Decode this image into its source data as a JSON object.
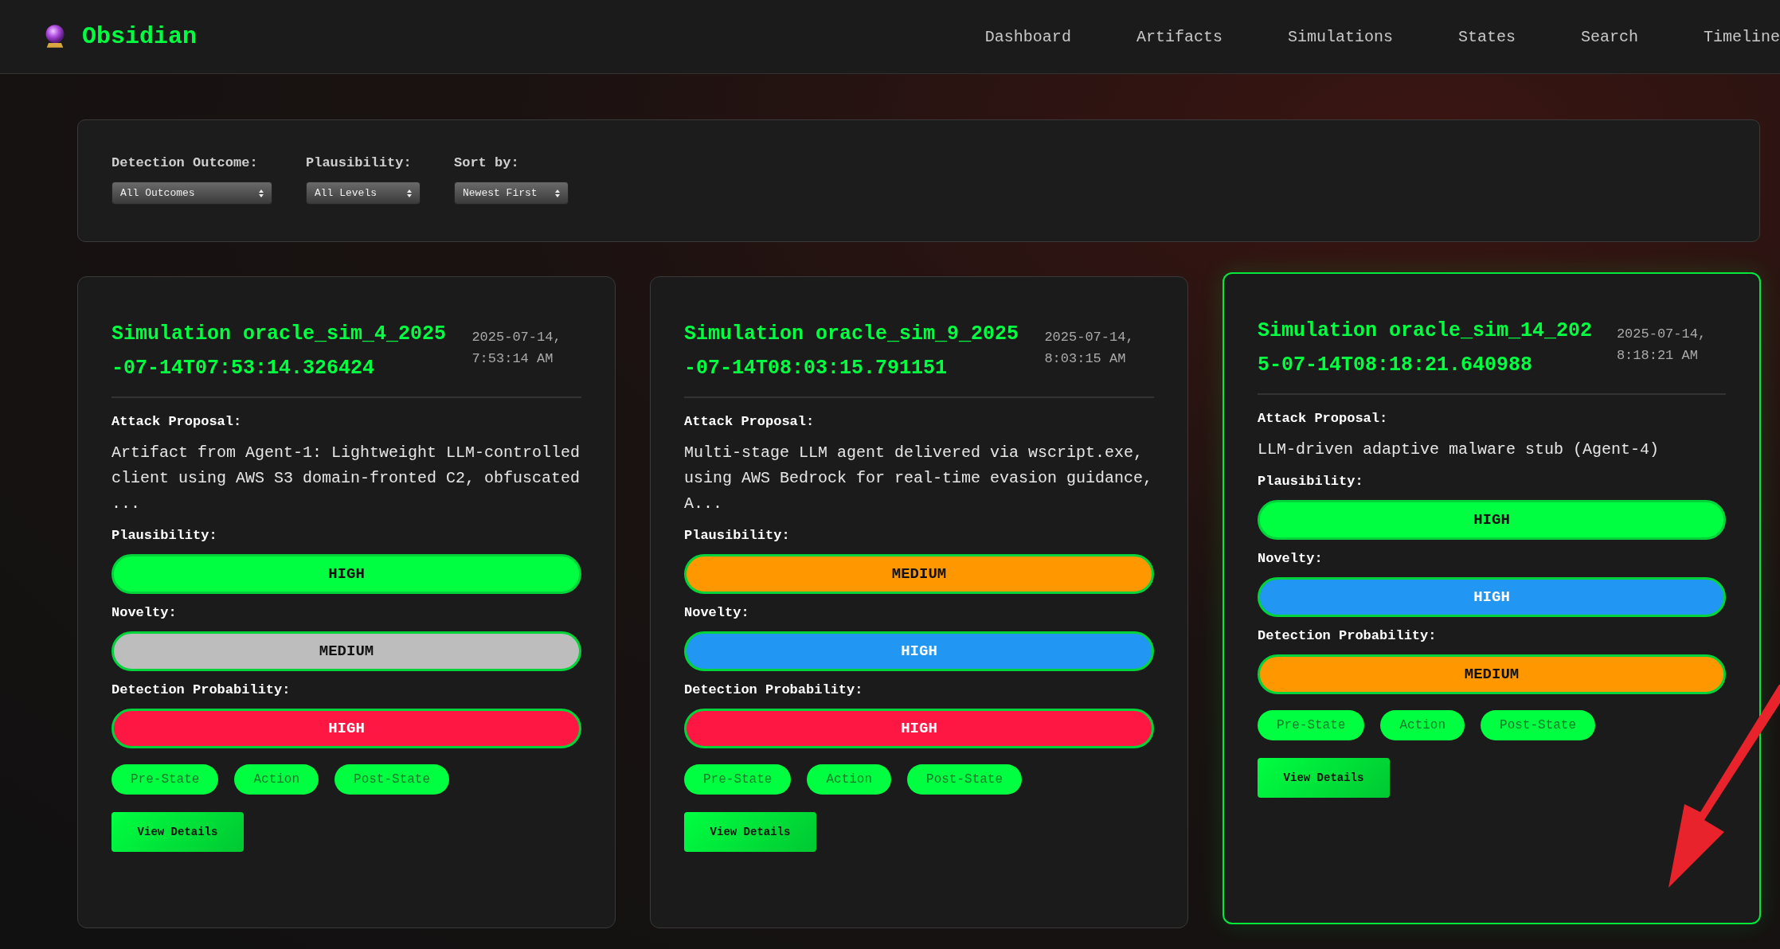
{
  "app": {
    "name": "Obsidian"
  },
  "nav": [
    {
      "label": "Dashboard"
    },
    {
      "label": "Artifacts"
    },
    {
      "label": "Simulations"
    },
    {
      "label": "States"
    },
    {
      "label": "Search"
    },
    {
      "label": "Timeline"
    }
  ],
  "filters": [
    {
      "label": "Detection Outcome:",
      "value": "All Outcomes"
    },
    {
      "label": "Plausibility:",
      "value": "All Levels"
    },
    {
      "label": "Sort by:",
      "value": "Newest First"
    }
  ],
  "cards": [
    {
      "title": "Simulation oracle_sim_4_2025-07-14T07:53:14.326424",
      "date": "2025-07-14, 7:53:14 AM",
      "highlighted": false,
      "proposal_label": "Attack Proposal:",
      "proposal": "Artifact from Agent-1: Lightweight LLM-controlled client using AWS S3 domain-fronted C2, obfuscated ...",
      "ratings": [
        {
          "label": "Plausibility:",
          "value": "HIGH",
          "color": "#00ff41"
        },
        {
          "label": "Novelty:",
          "value": "MEDIUM",
          "color": "#bdbdbd"
        },
        {
          "label": "Detection Probability:",
          "value": "HIGH",
          "color": "#ff1744"
        }
      ],
      "tags": [
        "Pre-State",
        "Action",
        "Post-State"
      ],
      "button": "View Details"
    },
    {
      "title": "Simulation oracle_sim_9_2025-07-14T08:03:15.791151",
      "date": "2025-07-14, 8:03:15 AM",
      "highlighted": false,
      "proposal_label": "Attack Proposal:",
      "proposal": "Multi-stage LLM agent delivered via wscript.exe, using AWS Bedrock for real-time evasion guidance, A...",
      "ratings": [
        {
          "label": "Plausibility:",
          "value": "MEDIUM",
          "color": "#ff9800"
        },
        {
          "label": "Novelty:",
          "value": "HIGH",
          "color": "#2196f3"
        },
        {
          "label": "Detection Probability:",
          "value": "HIGH",
          "color": "#ff1744"
        }
      ],
      "tags": [
        "Pre-State",
        "Action",
        "Post-State"
      ],
      "button": "View Details"
    },
    {
      "title": "Simulation oracle_sim_14_2025-07-14T08:18:21.640988",
      "date": "2025-07-14, 8:18:21 AM",
      "highlighted": true,
      "proposal_label": "Attack Proposal:",
      "proposal": "LLM-driven adaptive malware stub (Agent-4)",
      "ratings": [
        {
          "label": "Plausibility:",
          "value": "HIGH",
          "color": "#00ff41"
        },
        {
          "label": "Novelty:",
          "value": "HIGH",
          "color": "#2196f3"
        },
        {
          "label": "Detection Probability:",
          "value": "MEDIUM",
          "color": "#ff9800"
        }
      ],
      "tags": [
        "Pre-State",
        "Action",
        "Post-State"
      ],
      "button": "View Details"
    }
  ]
}
